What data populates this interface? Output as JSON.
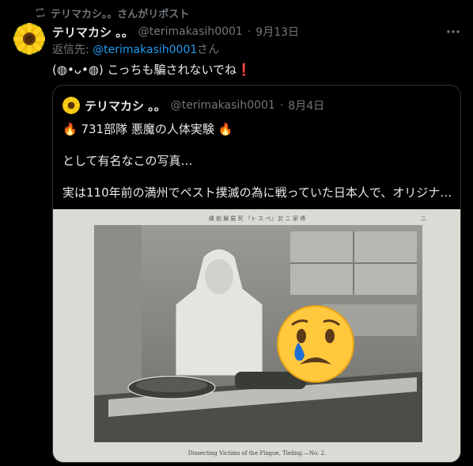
{
  "repost": {
    "label": "テリマカシ。。さんがリポスト",
    "icon": "repost-icon"
  },
  "tweet": {
    "display_name": "テリマカシ 。。",
    "handle": "@terimakasih0001",
    "separator": "·",
    "date": "9月13日",
    "reply_prefix": "返信先: ",
    "reply_mention": "@terimakasih0001",
    "reply_suffix": "さん",
    "text": "(◍•ᴗ•◍) こっちも騙されないでね❗"
  },
  "quoted": {
    "display_name": "テリマカシ 。。",
    "handle": "@terimakasih0001",
    "separator": "·",
    "date": "8月4日",
    "line1": "🔥 731部隊 悪魔の人体実験 🔥",
    "line2": "として有名なこの写真…",
    "line3": "実は110年前の満州でペスト撲滅の為に戦っていた日本人で、オリジナ…",
    "photo_header": "縄 剖 解 屍 死 『ト ス ぺ』 於 ニ 家 傅",
    "photo_caption": "Dissecting Victims of the Plague, Tieling.—No. 2.",
    "photo_page_number": "ニ"
  },
  "colors": {
    "background": "#000000",
    "text": "#e7e9ea",
    "secondary": "#71767b",
    "link": "#1d9bf0",
    "border": "#2f3336"
  }
}
